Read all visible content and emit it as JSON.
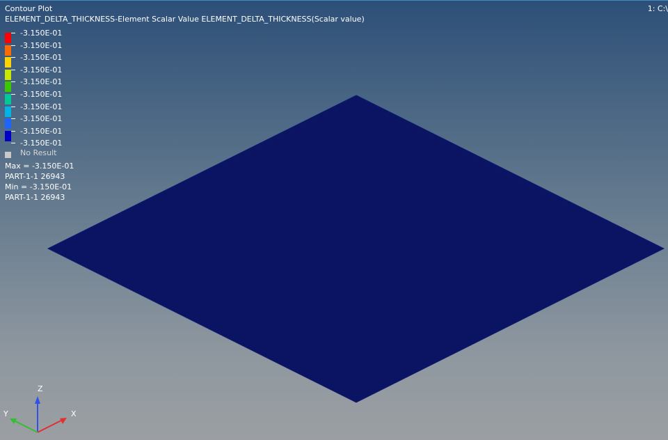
{
  "header": {
    "title": "Contour Plot",
    "subtitle": "ELEMENT_DELTA_THICKNESS-Element Scalar Value ELEMENT_DELTA_THICKNESS(Scalar value)",
    "window_label": "1: C:\\"
  },
  "legend": {
    "levels": [
      {
        "label": "-3.150E-01",
        "color": "#ff0000"
      },
      {
        "label": "-3.150E-01",
        "color": "#ff6a00"
      },
      {
        "label": "-3.150E-01",
        "color": "#ffd200"
      },
      {
        "label": "-3.150E-01",
        "color": "#c8e600"
      },
      {
        "label": "-3.150E-01",
        "color": "#3cc800"
      },
      {
        "label": "-3.150E-01",
        "color": "#00c896"
      },
      {
        "label": "-3.150E-01",
        "color": "#00b4e6"
      },
      {
        "label": "-3.150E-01",
        "color": "#1e64ff"
      },
      {
        "label": "-3.150E-01",
        "color": "#0000c8"
      }
    ],
    "last_label": "-3.150E-01",
    "no_result": {
      "label": "No Result",
      "color": "#c8c8c8"
    }
  },
  "stats": {
    "max": "Max = -3.150E-01",
    "max_part": "PART-1-1 26943",
    "min": "Min = -3.150E-01",
    "min_part": "PART-1-1 26943"
  },
  "model": {
    "plate_color": "#0b1463"
  },
  "triad": {
    "x_label": "X",
    "y_label": "Y",
    "z_label": "Z",
    "x_color": "#e23030",
    "y_color": "#30c030",
    "z_color": "#3050e8"
  }
}
